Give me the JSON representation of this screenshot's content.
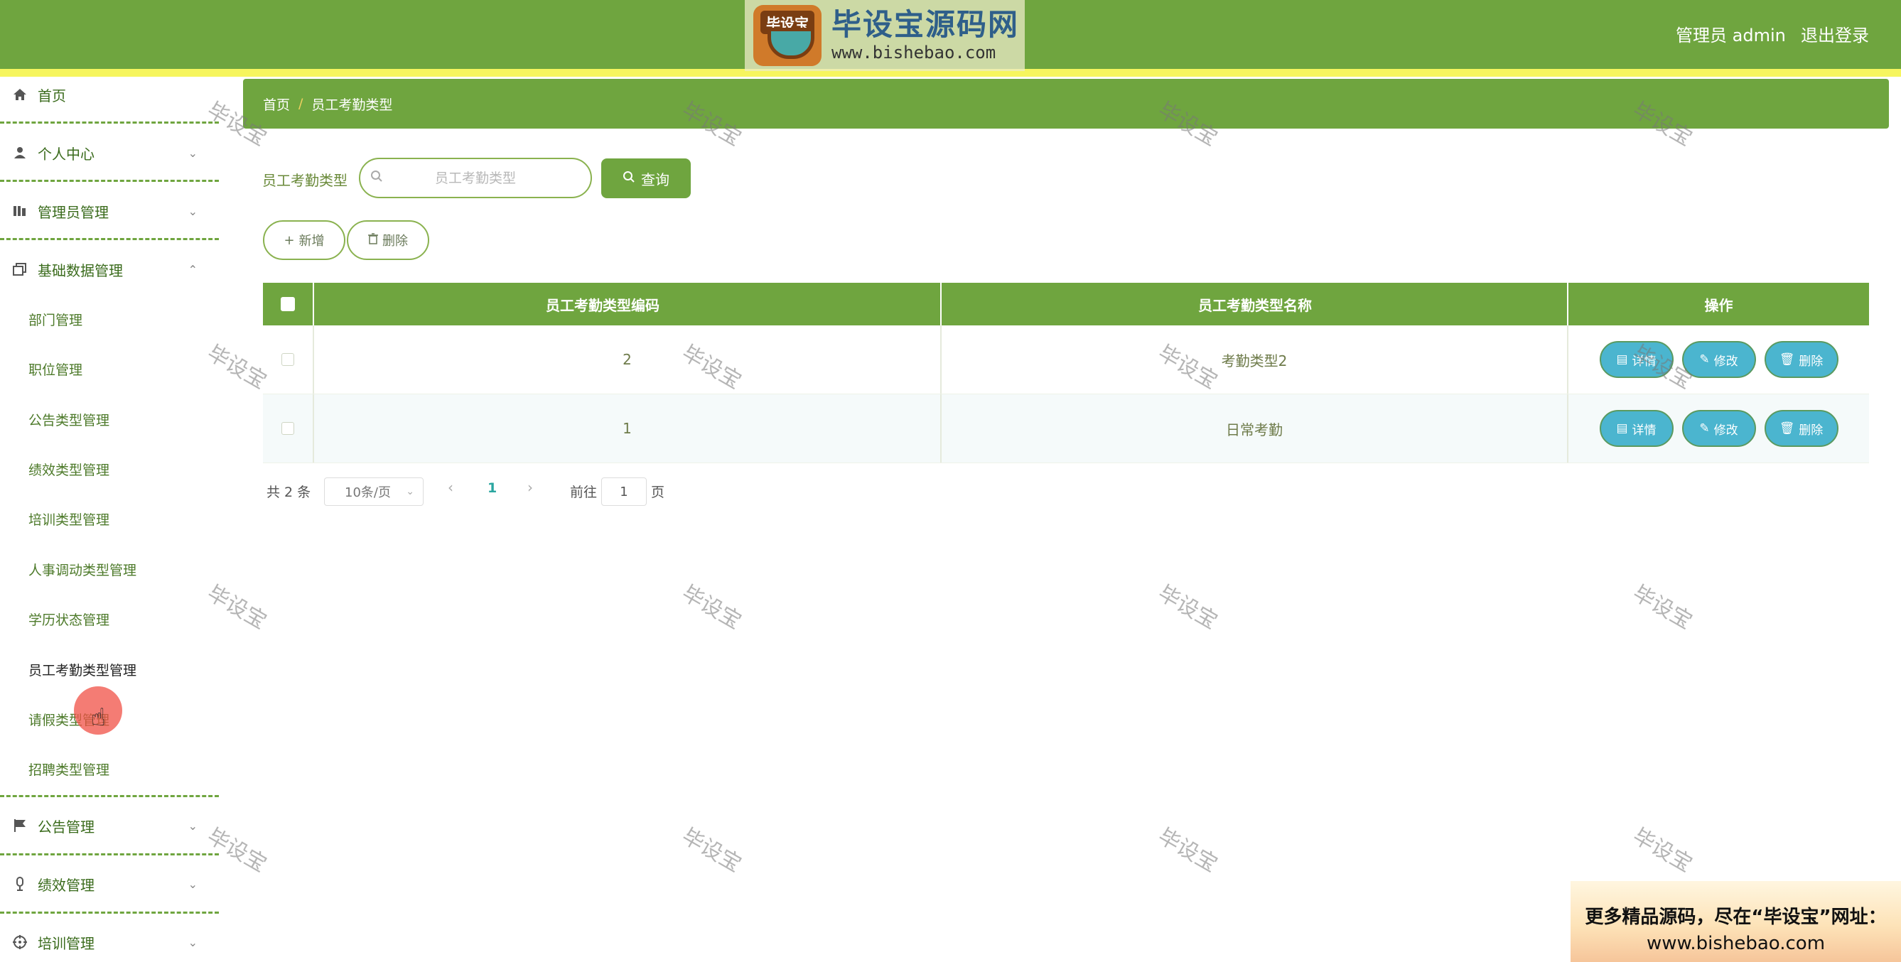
{
  "header": {
    "logo_badge": "毕设宝",
    "logo_title": "毕设宝源码网",
    "logo_url": "www.bishebao.com",
    "admin_label": "管理员 admin",
    "logout": "退出登录"
  },
  "sidebar": {
    "items": [
      {
        "label": "首页",
        "icon": "home-icon"
      },
      {
        "label": "个人中心",
        "icon": "user-icon"
      },
      {
        "label": "管理员管理",
        "icon": "admin-icon"
      },
      {
        "label": "基础数据管理",
        "icon": "copy-icon"
      },
      {
        "label": "公告管理",
        "icon": "flag-icon"
      },
      {
        "label": "绩效管理",
        "icon": "microphone-icon"
      },
      {
        "label": "培训管理",
        "icon": "target-icon"
      }
    ],
    "sub_items": [
      "部门管理",
      "职位管理",
      "公告类型管理",
      "绩效类型管理",
      "培训类型管理",
      "人事调动类型管理",
      "学历状态管理",
      "员工考勤类型管理",
      "请假类型管理",
      "招聘类型管理"
    ]
  },
  "breadcrumb": {
    "home": "首页",
    "separator": "/",
    "current": "员工考勤类型"
  },
  "search": {
    "label": "员工考勤类型",
    "placeholder": "员工考勤类型",
    "button": "查询"
  },
  "toolbar": {
    "add": "新增",
    "delete": "删除"
  },
  "table": {
    "columns": [
      "员工考勤类型编码",
      "员工考勤类型名称",
      "操作"
    ],
    "rows": [
      {
        "code": "2",
        "name": "考勤类型2"
      },
      {
        "code": "1",
        "name": "日常考勤"
      }
    ],
    "actions": {
      "detail": "详情",
      "edit": "修改",
      "delete": "删除"
    }
  },
  "pagination": {
    "total": "共 2 条",
    "page_size": "10条/页",
    "current_page": "1",
    "goto_prefix": "前往",
    "goto_value": "1",
    "goto_suffix": "页"
  },
  "watermark": "毕设宝",
  "promo": {
    "line1": "更多精品源码，尽在“毕设宝”网址：",
    "line2": "www.bishebao.com"
  },
  "colors": {
    "primary": "#6fa53f",
    "accent_yellow": "#f6f55e",
    "action_button": "#4bb5cf",
    "page_active": "#2aa6a0"
  }
}
